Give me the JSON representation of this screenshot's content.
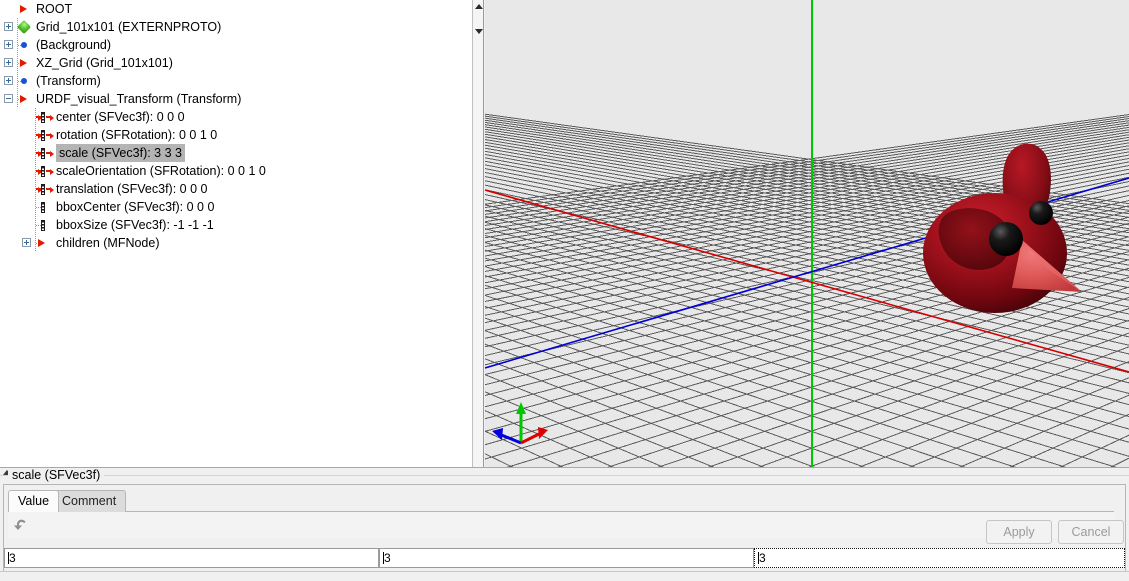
{
  "tree": {
    "rows": [
      {
        "id": "root",
        "label": "ROOT",
        "depth": 0,
        "icon": "red-triangle-icon",
        "expander": "none",
        "selected": false
      },
      {
        "id": "grid-externproto",
        "label": "Grid_101x101 (EXTERNPROTO)",
        "depth": 1,
        "icon": "green-diamond-icon",
        "expander": "plus",
        "selected": false
      },
      {
        "id": "background",
        "label": "(Background)",
        "depth": 1,
        "icon": "blue-dot-icon",
        "expander": "plus",
        "selected": false
      },
      {
        "id": "xz-grid",
        "label": "XZ_Grid (Grid_101x101)",
        "depth": 1,
        "icon": "red-triangle-icon",
        "expander": "plus",
        "selected": false
      },
      {
        "id": "transform",
        "label": "(Transform)",
        "depth": 1,
        "icon": "blue-dot-icon",
        "expander": "plus",
        "selected": false
      },
      {
        "id": "urdf-visual-transform",
        "label": "URDF_visual_Transform (Transform)",
        "depth": 1,
        "icon": "red-triangle-icon",
        "expander": "minus",
        "selected": false
      },
      {
        "id": "field-center",
        "label": "center (SFVec3f): 0  0  0",
        "depth": 2,
        "icon": "inputoutput-field-icon",
        "expander": "none",
        "selected": false
      },
      {
        "id": "field-rotation",
        "label": "rotation (SFRotation): 0  0  1  0",
        "depth": 2,
        "icon": "inputoutput-field-icon",
        "expander": "none",
        "selected": false
      },
      {
        "id": "field-scale",
        "label": "scale (SFVec3f): 3  3  3",
        "depth": 2,
        "icon": "inputoutput-field-icon",
        "expander": "none",
        "selected": true
      },
      {
        "id": "field-scaleorientation",
        "label": "scaleOrientation (SFRotation): 0  0  1  0",
        "depth": 2,
        "icon": "inputoutput-field-icon",
        "expander": "none",
        "selected": false
      },
      {
        "id": "field-translation",
        "label": "translation (SFVec3f): 0  0  0",
        "depth": 2,
        "icon": "inputoutput-field-icon",
        "expander": "none",
        "selected": false
      },
      {
        "id": "field-bboxcenter",
        "label": "bboxCenter (SFVec3f): 0  0  0",
        "depth": 2,
        "icon": "initializeonly-field-icon",
        "expander": "none",
        "selected": false
      },
      {
        "id": "field-bboxsize",
        "label": "bboxSize (SFVec3f): -1 -1 -1",
        "depth": 2,
        "icon": "initializeonly-field-icon",
        "expander": "none",
        "selected": false
      },
      {
        "id": "field-children",
        "label": "children (MFNode)",
        "depth": 2,
        "icon": "red-triangle-icon",
        "expander": "plus",
        "selected": false
      }
    ]
  },
  "viewport": {
    "background_color": "#e8e8e8",
    "grid_line_color": "#555555",
    "axis_x_color": "#d40000",
    "axis_y_color": "#00c800",
    "axis_z_color": "#0000d4",
    "model_color": "#9e0f18",
    "model_name": "cardinal-bird-head-model",
    "gizmo_name": "axis-orientation-gizmo"
  },
  "editor": {
    "group_title": "scale (SFVec3f)",
    "tabs": [
      {
        "id": "value",
        "label": "Value",
        "active": true
      },
      {
        "id": "comment",
        "label": "Comment",
        "active": false
      }
    ],
    "undo_icon": "undo-arrow-icon",
    "apply_label": "Apply",
    "cancel_label": "Cancel",
    "apply_enabled": false,
    "cancel_enabled": false,
    "fields": [
      {
        "id": "scale-x",
        "value": "3",
        "focused": false
      },
      {
        "id": "scale-y",
        "value": "3",
        "focused": false
      },
      {
        "id": "scale-z",
        "value": "3",
        "focused": true
      }
    ]
  }
}
